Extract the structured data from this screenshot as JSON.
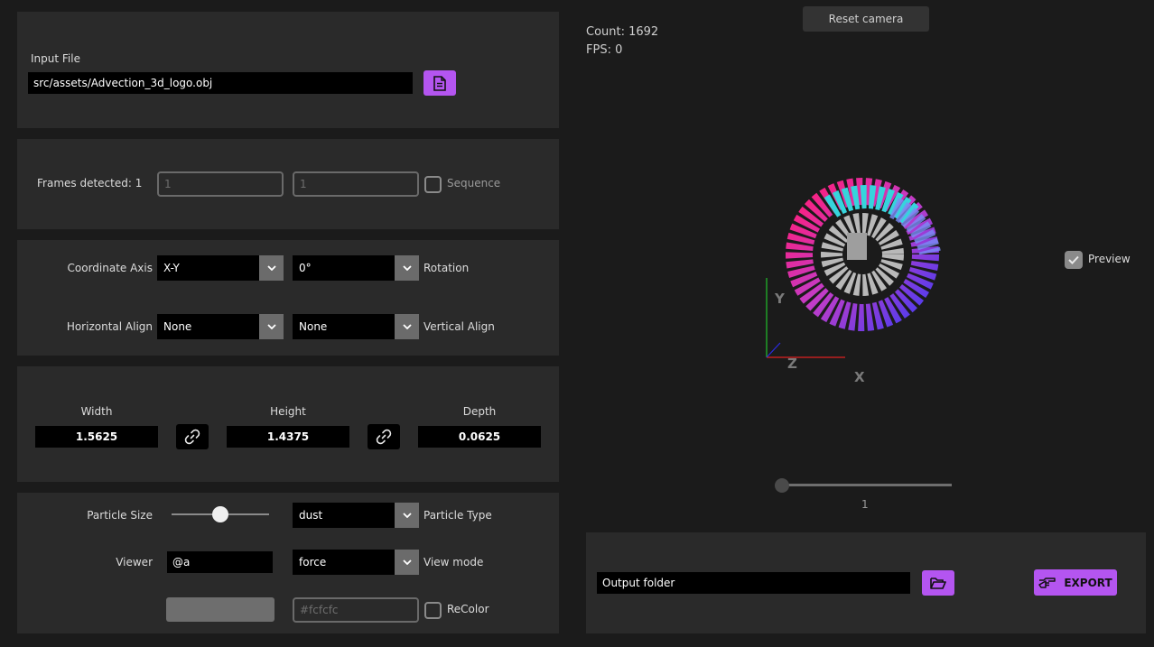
{
  "input_file": {
    "label": "Input File",
    "path": "src/assets/Advection_3d_logo.obj",
    "icon": "file-icon"
  },
  "frames": {
    "label": "Frames detected: 1",
    "start": "1",
    "end": "1",
    "sequence_label": "Sequence"
  },
  "transform": {
    "coordinate_axis_label": "Coordinate Axis",
    "coordinate_axis_value": "X-Y",
    "rotation_value": "0°",
    "rotation_label": "Rotation",
    "horizontal_align_label": "Horizontal Align",
    "horizontal_align_value": "None",
    "vertical_align_value": "None",
    "vertical_align_label": "Vertical Align"
  },
  "dimensions": {
    "width_label": "Width",
    "width_value": "1.5625",
    "height_label": "Height",
    "height_value": "1.4375",
    "depth_label": "Depth",
    "depth_value": "0.0625",
    "link_icon": "link-icon"
  },
  "particles": {
    "size_label": "Particle Size",
    "size_fraction": 0.5,
    "type_value": "dust",
    "type_label": "Particle Type",
    "viewer_label": "Viewer",
    "viewer_value": "@a",
    "view_mode_value": "force",
    "view_mode_label": "View mode",
    "color_placeholder": "#fcfcfc",
    "recolor_label": "ReColor"
  },
  "viewport": {
    "reset_camera": "Reset camera",
    "count": "Count: 1692",
    "fps": "FPS: 0",
    "preview_label": "Preview",
    "preview_checked": true,
    "axis_x": "X",
    "axis_y": "Y",
    "axis_z": "Z",
    "frame_slider_value": "1",
    "frame_slider_fraction": 0.0
  },
  "export": {
    "output_placeholder": "Output folder",
    "folder_icon": "folder-open-icon",
    "export_label": "EXPORT",
    "export_icon": "pointing-hand-icon"
  },
  "colors": {
    "accent": "#b455f0",
    "panel": "#2a2a2a",
    "background": "#1b1b1b"
  }
}
